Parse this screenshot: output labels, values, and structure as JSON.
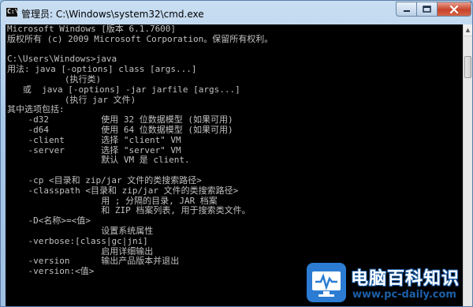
{
  "window": {
    "title": "管理员: C:\\Windows\\system32\\cmd.exe",
    "icon_text": "C:\\",
    "controls": {
      "minimize": "minimize-icon",
      "maximize": "maximize-icon",
      "close": "close-icon"
    }
  },
  "console": {
    "lines": [
      "Microsoft Windows [版本 6.1.7600]",
      "版权所有 (c) 2009 Microsoft Corporation。保留所有权利。",
      "",
      "C:\\Users\\Windows>java",
      "用法: java [-options] class [args...]",
      "           (执行类)",
      "   或  java [-options] -jar jarfile [args...]",
      "           (执行 jar 文件)",
      "其中选项包括:",
      "    -d32          使用 32 位数据模型 (如果可用)",
      "    -d64          使用 64 位数据模型 (如果可用)",
      "    -client       选择 \"client\" VM",
      "    -server       选择 \"server\" VM",
      "                  默认 VM 是 client.",
      "",
      "    -cp <目录和 zip/jar 文件的类搜索路径>",
      "    -classpath <目录和 zip/jar 文件的类搜索路径>",
      "                  用 ; 分隔的目录, JAR 档案",
      "                  和 ZIP 档案列表, 用于搜索类文件。",
      "    -D<名称>=<值>",
      "                  设置系统属性",
      "    -verbose:[class|gc|jni]",
      "                  启用详细输出",
      "    -version      输出产品版本并退出",
      "    -version:<值>"
    ]
  },
  "watermark": {
    "title": "电脑百科知识",
    "url": "www.pc-daily.com"
  },
  "colors": {
    "console_bg": "#000000",
    "console_text": "#c0c0c0",
    "close_button": "#c7432a",
    "watermark_blue": "#2b7cd2"
  }
}
